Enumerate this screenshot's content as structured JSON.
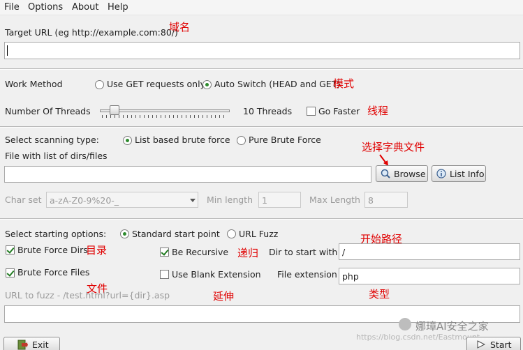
{
  "menu": [
    "File",
    "Options",
    "About",
    "Help"
  ],
  "target": {
    "label": "Target URL (eg http://example.com:80/)",
    "value": ""
  },
  "work_method": {
    "label": "Work Method",
    "options": [
      "Use GET requests only",
      "Auto Switch (HEAD and GET)"
    ],
    "selected": "Auto Switch (HEAD and GET)"
  },
  "threads": {
    "label": "Number Of Threads",
    "value_text": "10 Threads",
    "level": 0.06,
    "go_faster_label": "Go Faster",
    "go_faster_checked": false
  },
  "scan_type": {
    "label": "Select scanning type:",
    "options": [
      "List based brute force",
      "Pure Brute Force"
    ],
    "selected": "List based brute force"
  },
  "dirs_file": {
    "label": "File with list of dirs/files",
    "value": "",
    "browse": "Browse",
    "list_info": "List Info"
  },
  "charset": {
    "label": "Char set",
    "value": "a-zA-Z0-9%20-_",
    "min_label": "Min length",
    "min_value": "1",
    "max_label": "Max Length",
    "max_value": "8"
  },
  "start": {
    "label": "Select starting options:",
    "options": [
      "Standard start point",
      "URL Fuzz"
    ],
    "selected": "Standard start point",
    "brute_dirs": "Brute Force Dirs",
    "brute_files": "Brute Force Files",
    "recursive": "Be Recursive",
    "blank_ext": "Use Blank Extension",
    "dir_start_label": "Dir to start with",
    "dir_start_value": "/",
    "file_ext_label": "File extension",
    "file_ext_value": "php"
  },
  "fuzz": {
    "label": "URL to fuzz - /test.html?url={dir}.asp",
    "value": ""
  },
  "buttons": {
    "exit": "Exit",
    "start": "Start"
  },
  "annotations": {
    "domain": "域名",
    "mode": "模式",
    "threads": "线程",
    "dict": "选择字典文件",
    "start_path": "开始路径",
    "dirs": "目录",
    "recursive": "递归",
    "files": "文件",
    "extension": "延伸",
    "type": "类型"
  },
  "watermark": "娜璋AI安全之家",
  "watermark_url": "https://blog.csdn.net/Eastmount"
}
